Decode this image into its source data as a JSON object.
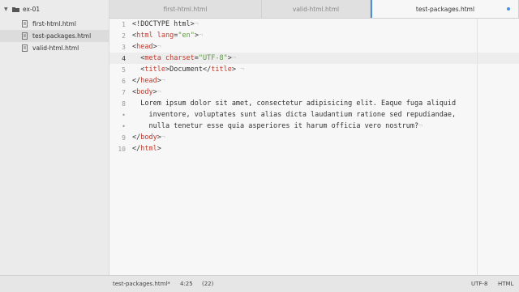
{
  "sidebar": {
    "project": "ex-01",
    "files": [
      {
        "name": "first-html.html"
      },
      {
        "name": "test-packages.html"
      },
      {
        "name": "valid-html.html"
      }
    ]
  },
  "tabs": [
    {
      "label": "first-html.html"
    },
    {
      "label": "valid-html.html"
    },
    {
      "label": "test-packages.html"
    }
  ],
  "editor": {
    "gutter": [
      "1",
      "2",
      "3",
      "4",
      "5",
      "6",
      "7",
      "8",
      "•",
      "•",
      "9",
      "10"
    ],
    "lines": [
      {
        "parts": [
          {
            "t": "<!DOCTYPE html>",
            "c": "tok-punct"
          },
          {
            "t": "¬",
            "c": "ws"
          }
        ]
      },
      {
        "parts": [
          {
            "t": "<",
            "c": "tok-punct"
          },
          {
            "t": "html",
            "c": "tok-tag"
          },
          {
            "t": " ",
            "c": "tok-punct"
          },
          {
            "t": "lang",
            "c": "tok-attr"
          },
          {
            "t": "=",
            "c": "tok-punct"
          },
          {
            "t": "\"en\"",
            "c": "tok-str"
          },
          {
            "t": ">",
            "c": "tok-punct"
          },
          {
            "t": "¬",
            "c": "ws"
          }
        ]
      },
      {
        "parts": [
          {
            "t": "<",
            "c": "tok-punct"
          },
          {
            "t": "head",
            "c": "tok-tag"
          },
          {
            "t": ">",
            "c": "tok-punct"
          },
          {
            "t": "¬",
            "c": "ws"
          }
        ]
      },
      {
        "parts": [
          {
            "t": "  <",
            "c": "tok-punct"
          },
          {
            "t": "meta",
            "c": "tok-tag"
          },
          {
            "t": " ",
            "c": "tok-punct"
          },
          {
            "t": "charset",
            "c": "tok-attr"
          },
          {
            "t": "=",
            "c": "tok-punct"
          },
          {
            "t": "\"UTF-8\"",
            "c": "tok-str"
          },
          {
            "t": ">",
            "c": "tok-punct"
          },
          {
            "t": "¬",
            "c": "ws"
          }
        ]
      },
      {
        "parts": [
          {
            "t": "  <",
            "c": "tok-punct"
          },
          {
            "t": "title",
            "c": "tok-tag"
          },
          {
            "t": ">",
            "c": "tok-punct"
          },
          {
            "t": "Document",
            "c": "tok-punct"
          },
          {
            "t": "</",
            "c": "tok-punct"
          },
          {
            "t": "title",
            "c": "tok-tag"
          },
          {
            "t": ">",
            "c": "tok-punct"
          },
          {
            "t": " ¬",
            "c": "ws"
          }
        ]
      },
      {
        "parts": [
          {
            "t": "</",
            "c": "tok-punct"
          },
          {
            "t": "head",
            "c": "tok-tag"
          },
          {
            "t": ">",
            "c": "tok-punct"
          },
          {
            "t": "¬",
            "c": "ws"
          }
        ]
      },
      {
        "parts": [
          {
            "t": "<",
            "c": "tok-punct"
          },
          {
            "t": "body",
            "c": "tok-tag"
          },
          {
            "t": ">",
            "c": "tok-punct"
          },
          {
            "t": "¬",
            "c": "ws"
          }
        ]
      },
      {
        "parts": [
          {
            "t": "  Lorem ipsum dolor sit amet, consectetur adipisicing elit. Eaque fuga aliquid",
            "c": "tok-punct"
          }
        ]
      },
      {
        "parts": [
          {
            "t": "    inventore, voluptates sunt alias dicta laudantium ratione sed repudiandae,",
            "c": "tok-punct"
          }
        ]
      },
      {
        "parts": [
          {
            "t": "    nulla tenetur esse quia asperiores it harum officia vero nostrum?",
            "c": "tok-punct"
          },
          {
            "t": "¬",
            "c": "ws"
          }
        ]
      },
      {
        "parts": [
          {
            "t": "</",
            "c": "tok-punct"
          },
          {
            "t": "body",
            "c": "tok-tag"
          },
          {
            "t": ">",
            "c": "tok-punct"
          },
          {
            "t": "¬",
            "c": "ws"
          }
        ]
      },
      {
        "parts": [
          {
            "t": "</",
            "c": "tok-punct"
          },
          {
            "t": "html",
            "c": "tok-tag"
          },
          {
            "t": ">",
            "c": "tok-punct"
          }
        ]
      }
    ]
  },
  "status": {
    "file": "test-packages.html*",
    "cursor": "4:25",
    "selection": "(22)",
    "encoding": "UTF-8",
    "grammar": "HTML"
  },
  "colors": {
    "accent": "#4a90e2",
    "tag": "#c0392b",
    "string": "#5a9a3a"
  }
}
